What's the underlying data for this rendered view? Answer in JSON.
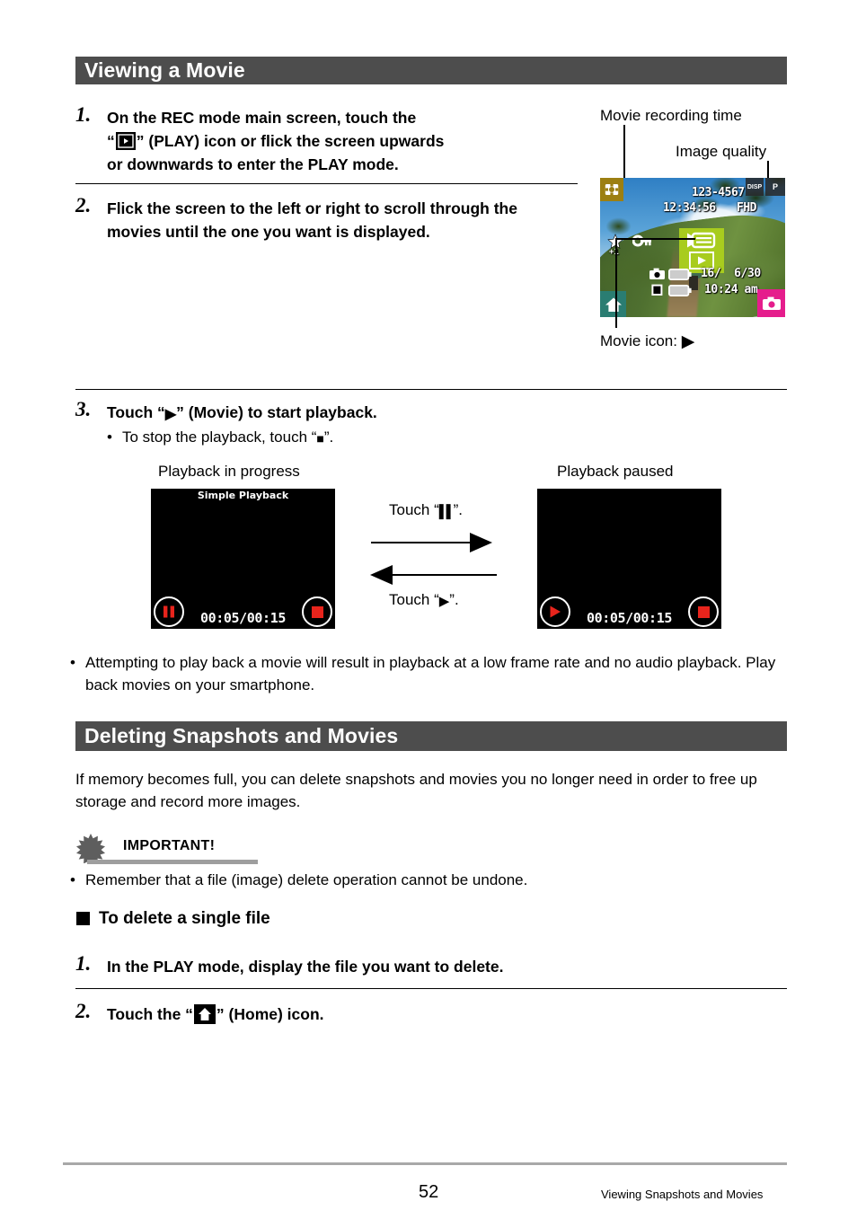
{
  "page": {
    "number": "52",
    "footer_text": "Viewing Snapshots and Movies"
  },
  "sections": [
    {
      "id": "viewing-a-movie",
      "title": "Viewing a Movie"
    },
    {
      "id": "deleting-snapshots-and-movies",
      "title": "Deleting Snapshots and Movies"
    }
  ],
  "steps": {
    "s1_num": "1.",
    "s1_line1": "On the REC mode main screen, touch the",
    "s1_line2a": "“",
    "s1_line2b": "” (PLAY) icon or flick the screen upwards",
    "s1_line3": "or downwards to enter the PLAY mode.",
    "s2_num": "2.",
    "s2_text": "Flick the screen to the left or right to scroll through the movies until the one you want is displayed.",
    "s3_num": "3.",
    "s3_a": "Touch “",
    "s3_b": "” (Movie) to start playback.",
    "s3_bullet_a": "To stop the playback, touch “",
    "s3_bullet_b": "”.",
    "d1_num": "1.",
    "d1_text": "In the PLAY mode, display the file you want to delete.",
    "d2_num": "2.",
    "d2_a": "Touch the “",
    "d2_b": "” (Home) icon."
  },
  "callouts": {
    "movie_recording_time": "Movie recording time",
    "image_quality": "Image quality",
    "movie_icon_label": "Movie icon:",
    "movie_icon_glyph": "▶"
  },
  "rec_screen": {
    "file_number": "123-4567",
    "recording_time": "12:34:56",
    "quality": "FHD",
    "disp_button": "DISP",
    "p_button": "P",
    "remaining": "16/  6/30",
    "clock": "10:24 am",
    "star_badge": "+1",
    "colors": {
      "home_icon_bg": "#2a7d72",
      "grid_icon_bg": "#9c7f12",
      "movie_panel_bg": "#a8cc1e",
      "camera_icon_bg": "#e51d8c"
    }
  },
  "playback": {
    "left_caption": "Playback in progress",
    "right_caption": "Playback paused",
    "left_title": "Simple Playback",
    "time_code": "00:05/00:15",
    "arrow_top_label_a": "Touch “",
    "arrow_top_label_b": "”.",
    "arrow_bottom_label_a": "Touch “",
    "arrow_bottom_label_b": "”.",
    "colors": {
      "button_red": "#e8241c"
    }
  },
  "notes": {
    "low_frame_rate": "Attempting to play back a movie will result in playback at a low frame rate and no audio playback. Play back movies on your smartphone.",
    "delete_intro": "If memory becomes full, you can delete snapshots and movies you no longer need in order to free up storage and record more images.",
    "important_label": "IMPORTANT!",
    "important_bullet": "Remember that a file (image) delete operation cannot be undone.",
    "to_delete_single": "To delete a single file"
  }
}
